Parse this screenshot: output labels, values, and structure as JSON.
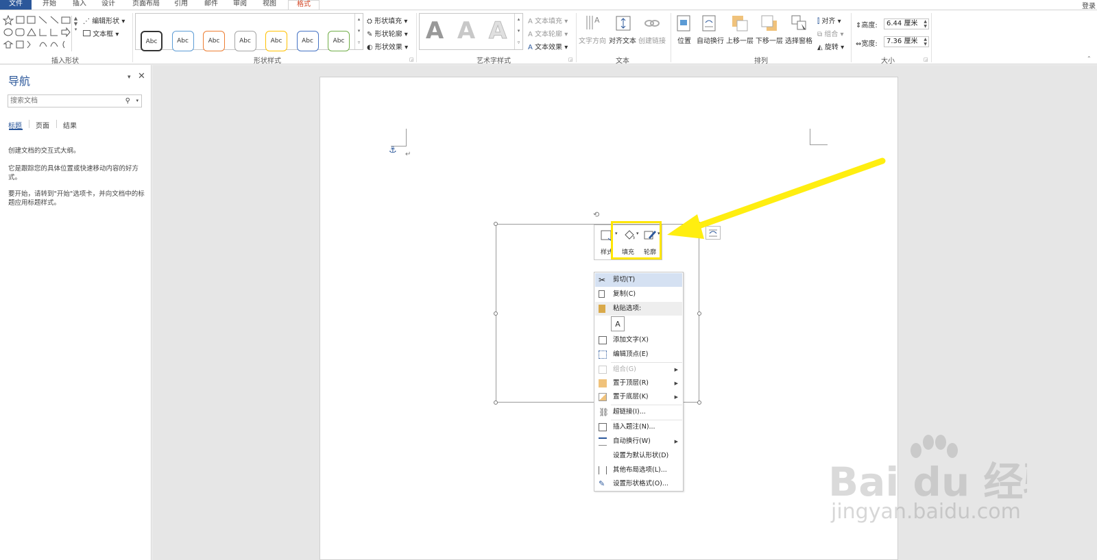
{
  "tabs": [
    {
      "label": "文件"
    },
    {
      "label": "开始"
    },
    {
      "label": "插入"
    },
    {
      "label": "设计"
    },
    {
      "label": "页面布局"
    },
    {
      "label": "引用"
    },
    {
      "label": "邮件"
    },
    {
      "label": "审阅"
    },
    {
      "label": "视图"
    },
    {
      "label": "格式"
    }
  ],
  "login": "登录",
  "ribbon": {
    "insert_shapes": {
      "edit_shape": "编辑形状",
      "text_box": "文本框",
      "label": "插入形状"
    },
    "shape_styles": {
      "thumb_text": "Abc",
      "fill": "形状填充",
      "outline": "形状轮廓",
      "effects": "形状效果",
      "label": "形状样式",
      "colors": [
        "#333333",
        "#5b9bd5",
        "#ed7d31",
        "#a5a5a5",
        "#ffc000",
        "#4472c4",
        "#70ad47"
      ]
    },
    "wordart": {
      "letter": "A",
      "text_fill": "文本填充",
      "text_outline": "文本轮廓",
      "text_effects": "文本效果",
      "label": "艺术字样式"
    },
    "text": {
      "direction": "文字方向",
      "align": "对齐文本",
      "link": "创建链接",
      "label": "文本"
    },
    "arrange": {
      "position": "位置",
      "wrap": "自动换行",
      "forward": "上移一层",
      "backward": "下移一层",
      "pane": "选择窗格",
      "align": "对齐",
      "group": "组合",
      "rotate": "旋转",
      "label": "排列"
    },
    "size": {
      "height_label": "高度:",
      "height": "6.44 厘米",
      "width_label": "宽度:",
      "width": "7.36 厘米",
      "label": "大小"
    }
  },
  "nav": {
    "title": "导航",
    "search_placeholder": "搜索文档",
    "tabs": [
      "标题",
      "页面",
      "结果"
    ],
    "line1": "创建文档的交互式大纲。",
    "line2": "它是跟踪您的具体位置或快速移动内容的好方式。",
    "line3": "要开始，请转到\"开始\"选项卡，并向文档中的标题应用标题样式。"
  },
  "mini": {
    "style": "样式",
    "fill": "填充",
    "outline": "轮廓"
  },
  "menu": [
    {
      "label": "剪切(T)"
    },
    {
      "label": "复制(C)"
    },
    {
      "label": "粘贴选项:"
    },
    {
      "label": "添加文字(X)"
    },
    {
      "label": "编辑顶点(E)"
    },
    {
      "label": "组合(G)"
    },
    {
      "label": "置于顶层(R)"
    },
    {
      "label": "置于底层(K)"
    },
    {
      "label": "超链接(I)..."
    },
    {
      "label": "插入题注(N)..."
    },
    {
      "label": "自动换行(W)"
    },
    {
      "label": "设置为默认形状(D)"
    },
    {
      "label": "其他布局选项(L)..."
    },
    {
      "label": "设置形状格式(O)..."
    }
  ],
  "watermark": {
    "logo": "Bai du 经验",
    "url": "jingyan.baidu.com"
  }
}
